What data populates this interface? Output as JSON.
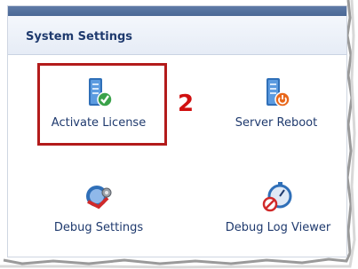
{
  "panel": {
    "title": "System Settings"
  },
  "tiles": [
    {
      "label": "Activate License",
      "icon": "server-check-icon"
    },
    {
      "label": "Server Reboot",
      "icon": "server-power-icon"
    },
    {
      "label": "Debug Settings",
      "icon": "debug-gear-icon"
    },
    {
      "label": "Debug Log Viewer",
      "icon": "stopwatch-no-icon"
    }
  ],
  "annotation": {
    "step": "2",
    "color": "#d01010"
  },
  "colors": {
    "header_text": "#1f3a6e",
    "highlight_border": "#b31b1b"
  }
}
